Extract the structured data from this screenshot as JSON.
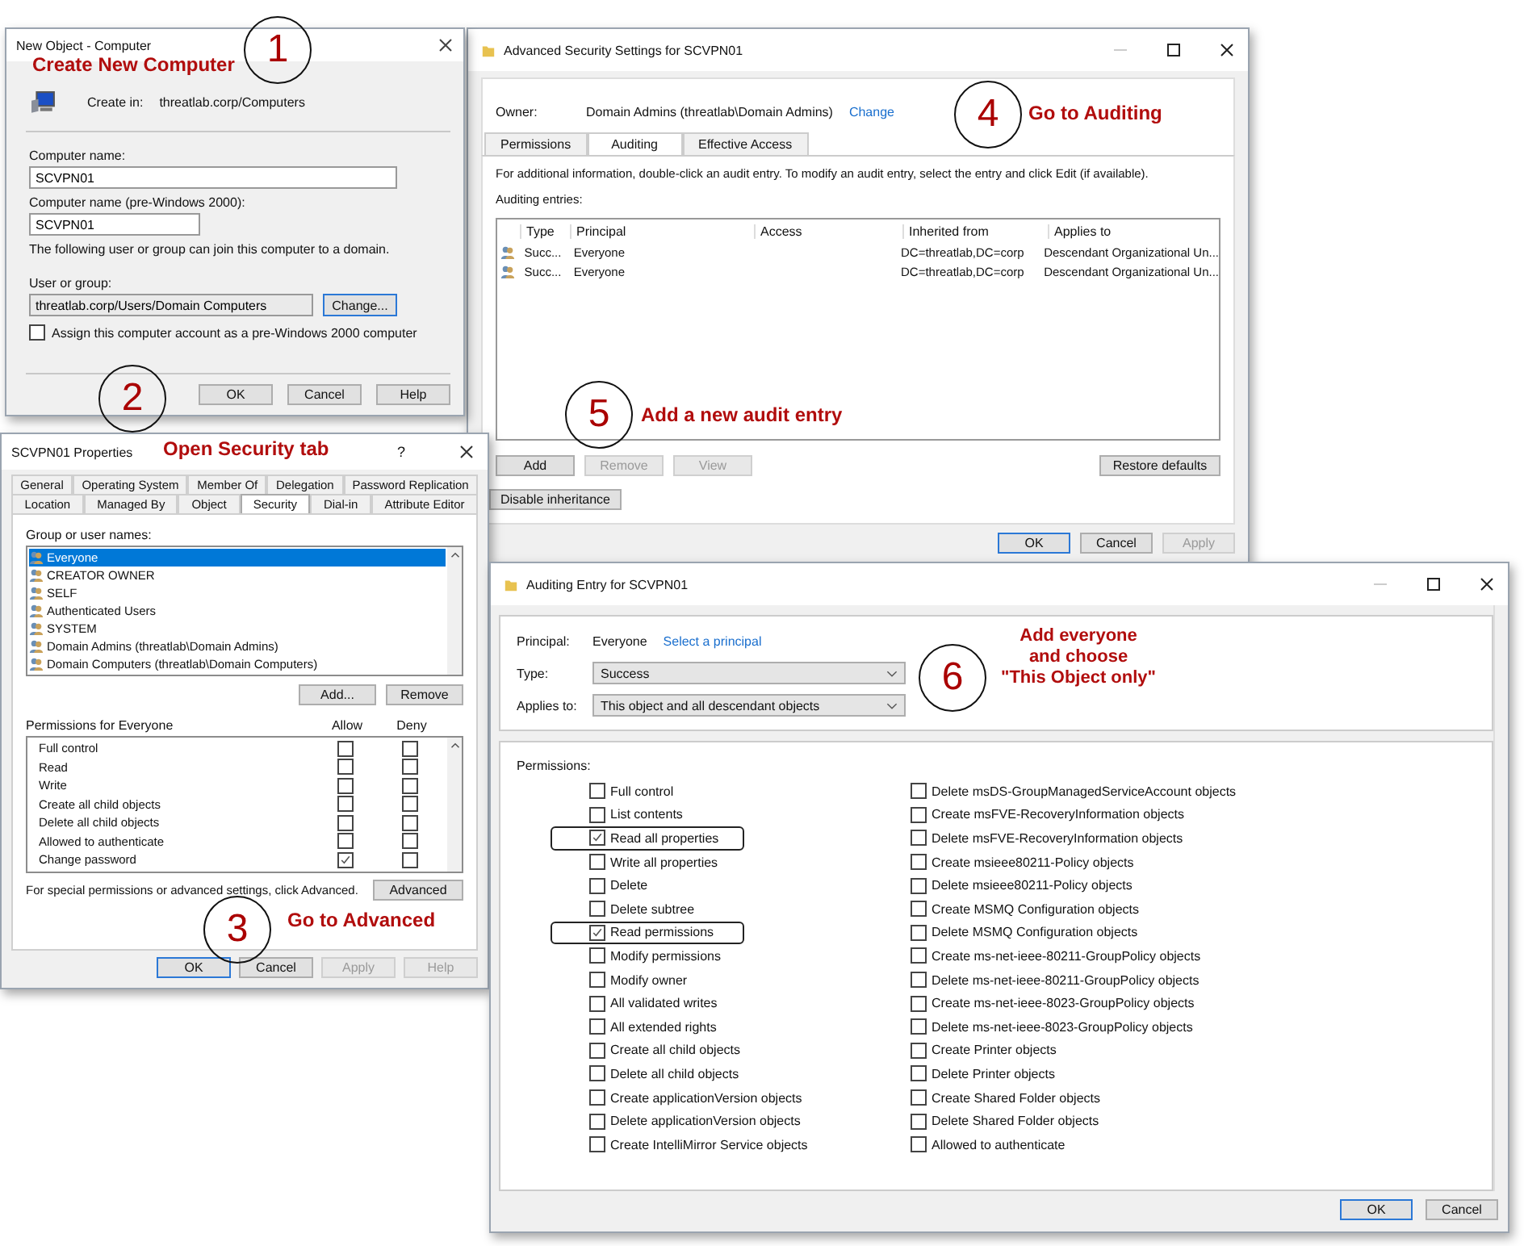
{
  "steps": [
    {
      "number": "1",
      "label": [
        "Create New Computer"
      ]
    },
    {
      "number": "2",
      "label": [
        "Open Security tab"
      ]
    },
    {
      "number": "3",
      "label": [
        "Go to Advanced"
      ]
    },
    {
      "number": "4",
      "label": [
        "Go to Auditing"
      ]
    },
    {
      "number": "5",
      "label": [
        "Add a new audit entry"
      ]
    },
    {
      "number": "6",
      "label": [
        "Add everyone",
        "and choose",
        "\"This Object only\""
      ]
    }
  ],
  "advanced_dialog": {
    "title": "Advanced Security Settings for SCVPN01",
    "owner_label": "Owner:",
    "owner_value": "Domain Admins (threatlab\\Domain Admins)",
    "change_link": "Change",
    "tabs": [
      {
        "label": "Permissions",
        "selected": false
      },
      {
        "label": "Auditing",
        "selected": true
      },
      {
        "label": "Effective Access",
        "selected": false
      }
    ],
    "info": "For additional information, double-click an audit entry. To modify an audit entry, select the entry and click Edit (if available).",
    "entries_label": "Auditing entries:",
    "columns": [
      "Type",
      "Principal",
      "Access",
      "Inherited from",
      "Applies to"
    ],
    "rows": [
      {
        "type": "Succ...",
        "principal": "Everyone",
        "inherited_from": "DC=threatlab,DC=corp",
        "applies_to": "Descendant Organizational Un..."
      },
      {
        "type": "Succ...",
        "principal": "Everyone",
        "inherited_from": "DC=threatlab,DC=corp",
        "applies_to": "Descendant Organizational Un..."
      }
    ],
    "entry_buttons": [
      {
        "label": "Add",
        "disabled": false
      },
      {
        "label": "Remove",
        "disabled": true
      },
      {
        "label": "View",
        "disabled": true
      }
    ],
    "restore_button": "Restore defaults",
    "inheritance_button": "Disable inheritance",
    "buttons": [
      {
        "label": "OK",
        "disabled": false,
        "default": true
      },
      {
        "label": "Cancel",
        "disabled": false,
        "default": false
      },
      {
        "label": "Apply",
        "disabled": true,
        "default": false
      }
    ]
  },
  "new_object_dialog": {
    "title": "New Object - Computer",
    "create_in_label": "Create in:",
    "create_in_value": "threatlab.corp/Computers",
    "computer_name_label": "Computer name:",
    "computer_name_value": "SCVPN01",
    "pre2000_label": "Computer name (pre-Windows 2000):",
    "pre2000_value": "SCVPN01",
    "join_note": "The following user or group can join this computer to a domain.",
    "user_group_label": "User or group:",
    "user_group_value": "threatlab.corp/Users/Domain Computers",
    "change_button": "Change...",
    "assign_checkbox": {
      "label": "Assign this computer account as a pre-Windows 2000 computer",
      "checked": false
    },
    "buttons": [
      {
        "label": "OK",
        "disabled": false,
        "default": false
      },
      {
        "label": "Cancel",
        "disabled": false,
        "default": false
      },
      {
        "label": "Help",
        "disabled": false,
        "default": false
      }
    ]
  },
  "properties_dialog": {
    "title": "SCVPN01 Properties",
    "help": "?",
    "tab_rows": [
      [
        {
          "label": "General",
          "selected": false
        },
        {
          "label": "Operating System",
          "selected": false
        },
        {
          "label": "Member Of",
          "selected": false
        },
        {
          "label": "Delegation",
          "selected": false
        },
        {
          "label": "Password Replication",
          "selected": false
        }
      ],
      [
        {
          "label": "Location",
          "selected": false
        },
        {
          "label": "Managed By",
          "selected": false
        },
        {
          "label": "Object",
          "selected": false
        },
        {
          "label": "Security",
          "selected": true
        },
        {
          "label": "Dial-in",
          "selected": false
        },
        {
          "label": "Attribute Editor",
          "selected": false
        }
      ]
    ],
    "group_label": "Group or user names:",
    "users": [
      {
        "name": "Everyone",
        "selected": true
      },
      {
        "name": "CREATOR OWNER",
        "selected": false
      },
      {
        "name": "SELF",
        "selected": false
      },
      {
        "name": "Authenticated Users",
        "selected": false
      },
      {
        "name": "SYSTEM",
        "selected": false
      },
      {
        "name": "Domain Admins (threatlab\\Domain Admins)",
        "selected": false
      },
      {
        "name": "Domain Computers (threatlab\\Domain Computers)",
        "selected": false
      }
    ],
    "add_button": "Add...",
    "remove_button": "Remove",
    "permissions_label": "Permissions for Everyone",
    "allow_label": "Allow",
    "deny_label": "Deny",
    "permissions": [
      {
        "name": "Full control",
        "allow": false,
        "deny": false
      },
      {
        "name": "Read",
        "allow": false,
        "deny": false
      },
      {
        "name": "Write",
        "allow": false,
        "deny": false
      },
      {
        "name": "Create all child objects",
        "allow": false,
        "deny": false
      },
      {
        "name": "Delete all child objects",
        "allow": false,
        "deny": false
      },
      {
        "name": "Allowed to authenticate",
        "allow": false,
        "deny": false
      },
      {
        "name": "Change password",
        "allow": true,
        "deny": false
      }
    ],
    "advanced_note": "For special permissions or advanced settings, click Advanced.",
    "advanced_button": "Advanced",
    "buttons": [
      {
        "label": "OK",
        "disabled": false,
        "default": true
      },
      {
        "label": "Cancel",
        "disabled": false,
        "default": false
      },
      {
        "label": "Apply",
        "disabled": true,
        "default": false
      },
      {
        "label": "Help",
        "disabled": true,
        "default": false
      }
    ]
  },
  "audit_entry_dialog": {
    "title": "Auditing Entry for SCVPN01",
    "principal_label": "Principal:",
    "principal_value": "Everyone",
    "select_link": "Select a principal",
    "type_label": "Type:",
    "type_value": "Success",
    "applies_label": "Applies to:",
    "applies_value": "This object and all descendant objects",
    "permissions_label": "Permissions:",
    "permission_columns": [
      [
        {
          "name": "Full control",
          "checked": false,
          "highlighted": false
        },
        {
          "name": "List contents",
          "checked": false,
          "highlighted": false
        },
        {
          "name": "Read all properties",
          "checked": true,
          "highlighted": true
        },
        {
          "name": "Write all properties",
          "checked": false,
          "highlighted": false
        },
        {
          "name": "Delete",
          "checked": false,
          "highlighted": false
        },
        {
          "name": "Delete subtree",
          "checked": false,
          "highlighted": false
        },
        {
          "name": "Read permissions",
          "checked": true,
          "highlighted": true
        },
        {
          "name": "Modify permissions",
          "checked": false,
          "highlighted": false
        },
        {
          "name": "Modify owner",
          "checked": false,
          "highlighted": false
        },
        {
          "name": "All validated writes",
          "checked": false,
          "highlighted": false
        },
        {
          "name": "All extended rights",
          "checked": false,
          "highlighted": false
        },
        {
          "name": "Create all child objects",
          "checked": false,
          "highlighted": false
        },
        {
          "name": "Delete all child objects",
          "checked": false,
          "highlighted": false
        },
        {
          "name": "Create applicationVersion objects",
          "checked": false,
          "highlighted": false
        },
        {
          "name": "Delete applicationVersion objects",
          "checked": false,
          "highlighted": false
        },
        {
          "name": "Create IntelliMirror Service objects",
          "checked": false,
          "highlighted": false
        }
      ],
      [
        {
          "name": "Delete msDS-GroupManagedServiceAccount objects",
          "checked": false,
          "highlighted": false
        },
        {
          "name": "Create msFVE-RecoveryInformation objects",
          "checked": false,
          "highlighted": false
        },
        {
          "name": "Delete msFVE-RecoveryInformation objects",
          "checked": false,
          "highlighted": false
        },
        {
          "name": "Create msieee80211-Policy objects",
          "checked": false,
          "highlighted": false
        },
        {
          "name": "Delete msieee80211-Policy objects",
          "checked": false,
          "highlighted": false
        },
        {
          "name": "Create MSMQ Configuration objects",
          "checked": false,
          "highlighted": false
        },
        {
          "name": "Delete MSMQ Configuration objects",
          "checked": false,
          "highlighted": false
        },
        {
          "name": "Create ms-net-ieee-80211-GroupPolicy objects",
          "checked": false,
          "highlighted": false
        },
        {
          "name": "Delete ms-net-ieee-80211-GroupPolicy objects",
          "checked": false,
          "highlighted": false
        },
        {
          "name": "Create ms-net-ieee-8023-GroupPolicy objects",
          "checked": false,
          "highlighted": false
        },
        {
          "name": "Delete ms-net-ieee-8023-GroupPolicy objects",
          "checked": false,
          "highlighted": false
        },
        {
          "name": "Create Printer objects",
          "checked": false,
          "highlighted": false
        },
        {
          "name": "Delete Printer objects",
          "checked": false,
          "highlighted": false
        },
        {
          "name": "Create Shared Folder objects",
          "checked": false,
          "highlighted": false
        },
        {
          "name": "Delete Shared Folder objects",
          "checked": false,
          "highlighted": false
        },
        {
          "name": "Allowed to authenticate",
          "checked": false,
          "highlighted": false
        }
      ]
    ],
    "buttons": [
      {
        "label": "OK",
        "disabled": false,
        "default": true
      },
      {
        "label": "Cancel",
        "disabled": false,
        "default": false
      }
    ]
  }
}
